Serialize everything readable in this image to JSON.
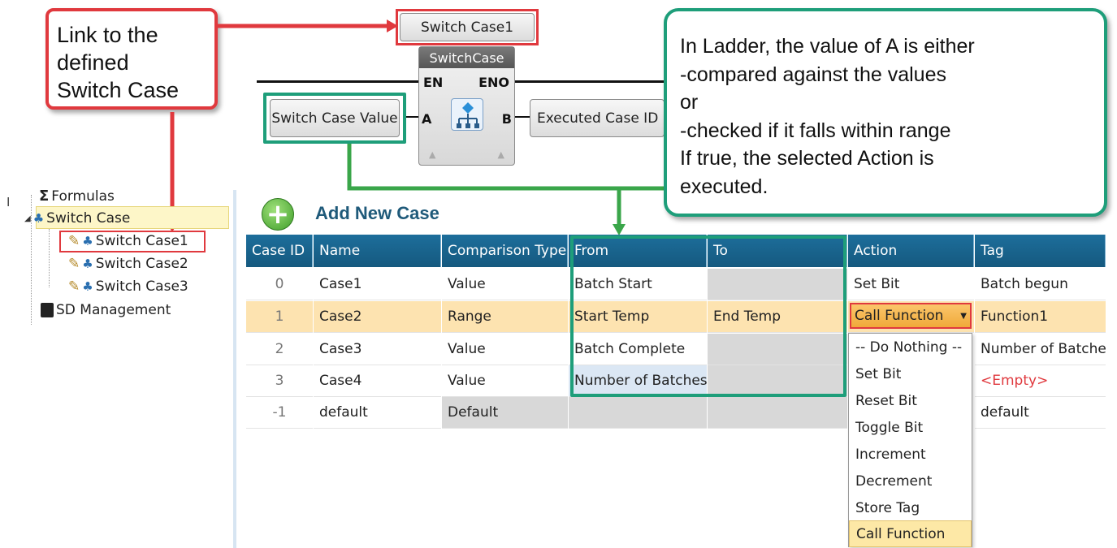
{
  "callouts": {
    "link": [
      "Link to the",
      "defined",
      "Switch Case"
    ],
    "ladder_note": [
      "In Ladder, the value of A is  either",
      "-compared against the values",
      "or",
      "-checked if it falls within range",
      "If true, the selected Action is",
      "executed."
    ]
  },
  "ladder": {
    "switch_case_button": "Switch Case1",
    "block_title": "SwitchCase",
    "en_label": "EN",
    "eno_label": "ENO",
    "input_a_label": "A",
    "output_b_label": "B",
    "input_value_button": "Switch Case Value",
    "output_value_button": "Executed Case ID"
  },
  "tree": {
    "items": [
      {
        "label": "Formulas"
      },
      {
        "label": "Switch Case"
      },
      {
        "label": "Switch Case1"
      },
      {
        "label": "Switch Case2"
      },
      {
        "label": "Switch Case3"
      },
      {
        "label": "SD Management"
      }
    ]
  },
  "add_case_label": "Add New Case",
  "grid": {
    "headers": [
      "Case ID",
      "Name",
      "Comparison Type",
      "From",
      "To",
      "Action",
      "Tag"
    ],
    "rows": [
      [
        "0",
        "Case1",
        "Value",
        "Batch Start",
        "",
        "Set Bit",
        "Batch begun"
      ],
      [
        "1",
        "Case2",
        "Range",
        "Start Temp",
        "End Temp",
        "Call Function",
        "Function1"
      ],
      [
        "2",
        "Case3",
        "Value",
        "Batch Complete",
        "",
        "",
        "Number of Batches"
      ],
      [
        "3",
        "Case4",
        "Value",
        "Number of Batches",
        "",
        "",
        "<Empty>"
      ],
      [
        "-1",
        "default",
        "Default",
        "",
        "",
        "",
        "default"
      ]
    ]
  },
  "action_dropdown": {
    "selected": "Call Function",
    "options": [
      "-- Do Nothing --",
      "Set Bit",
      "Reset Bit",
      "Toggle Bit",
      "Increment",
      "Decrement",
      "Store Tag",
      "Call Function"
    ]
  },
  "colors": {
    "red_callout": "#e0393e",
    "green_callout": "#1e9e7a",
    "grid_header": "#1d6e9b",
    "empty_tag": "#e0393e"
  }
}
